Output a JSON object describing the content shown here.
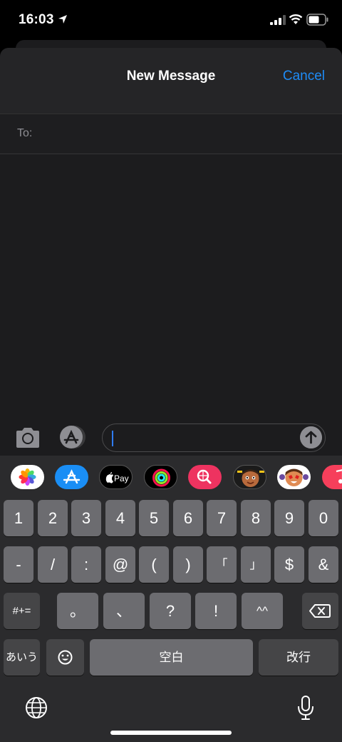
{
  "status_bar": {
    "time": "16:03"
  },
  "nav": {
    "title": "New Message",
    "cancel_label": "Cancel"
  },
  "compose": {
    "to_label": "To:",
    "text_value": ""
  },
  "app_strip": [
    {
      "name": "photos-app-icon"
    },
    {
      "name": "app-store-app-icon"
    },
    {
      "name": "apple-pay-app-icon",
      "label": "Pay"
    },
    {
      "name": "activity-app-icon"
    },
    {
      "name": "web-search-app-icon"
    },
    {
      "name": "memoji-app-icon"
    },
    {
      "name": "memoji-stickers-app-icon"
    },
    {
      "name": "music-app-icon"
    }
  ],
  "keyboard": {
    "row1": [
      "1",
      "2",
      "3",
      "4",
      "5",
      "6",
      "7",
      "8",
      "9",
      "0"
    ],
    "row2": [
      "-",
      "/",
      ":",
      "@",
      "(",
      ")",
      "「",
      "」",
      "$",
      "&"
    ],
    "row3": {
      "shift": "#+=",
      "keys": [
        "。",
        "、",
        "?",
        "!",
        "^^"
      ]
    },
    "row4": {
      "kana": "あいう",
      "space": "空白",
      "return": "改行"
    }
  },
  "colors": {
    "accent": "#1e8cf7",
    "key": "#6c6c70",
    "key_dark": "#454547",
    "keyboard_bg": "#2b2b2d"
  }
}
